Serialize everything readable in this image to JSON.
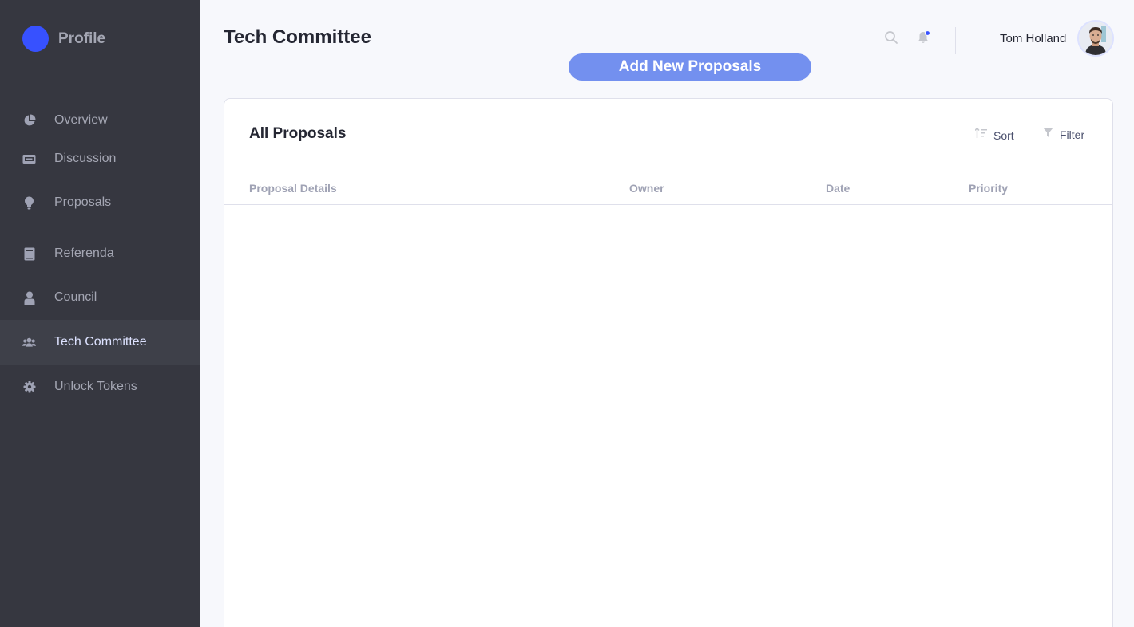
{
  "brand": {
    "label": "Profile",
    "color": "#3751ff"
  },
  "sidebar": {
    "items": [
      {
        "label": "Overview",
        "icon": "pie-chart-icon"
      },
      {
        "label": "Discussion",
        "icon": "ticket-icon"
      },
      {
        "label": "Proposals",
        "icon": "lightbulb-icon"
      },
      {
        "label": "Referenda",
        "icon": "book-icon"
      },
      {
        "label": "Council",
        "icon": "person-icon"
      },
      {
        "label": "Tech Committee",
        "icon": "group-icon",
        "active": true
      },
      {
        "label": "Unlock Tokens",
        "icon": "gear-icon"
      }
    ]
  },
  "header": {
    "title": "Tech Committee",
    "add_button": "Add New Proposals",
    "user_name": "Tom Holland",
    "notification_dot_color": "#3751ff"
  },
  "card": {
    "title": "All Proposals",
    "sort_label": "Sort",
    "filter_label": "Filter",
    "columns": [
      "Proposal Details",
      "Owner",
      "Date",
      "Priority"
    ],
    "rows": []
  },
  "colors": {
    "sidebar_bg": "#363740",
    "sidebar_active_bg": "#3e4049",
    "accent_button": "#7390ef",
    "page_bg": "#f7f8fc"
  }
}
